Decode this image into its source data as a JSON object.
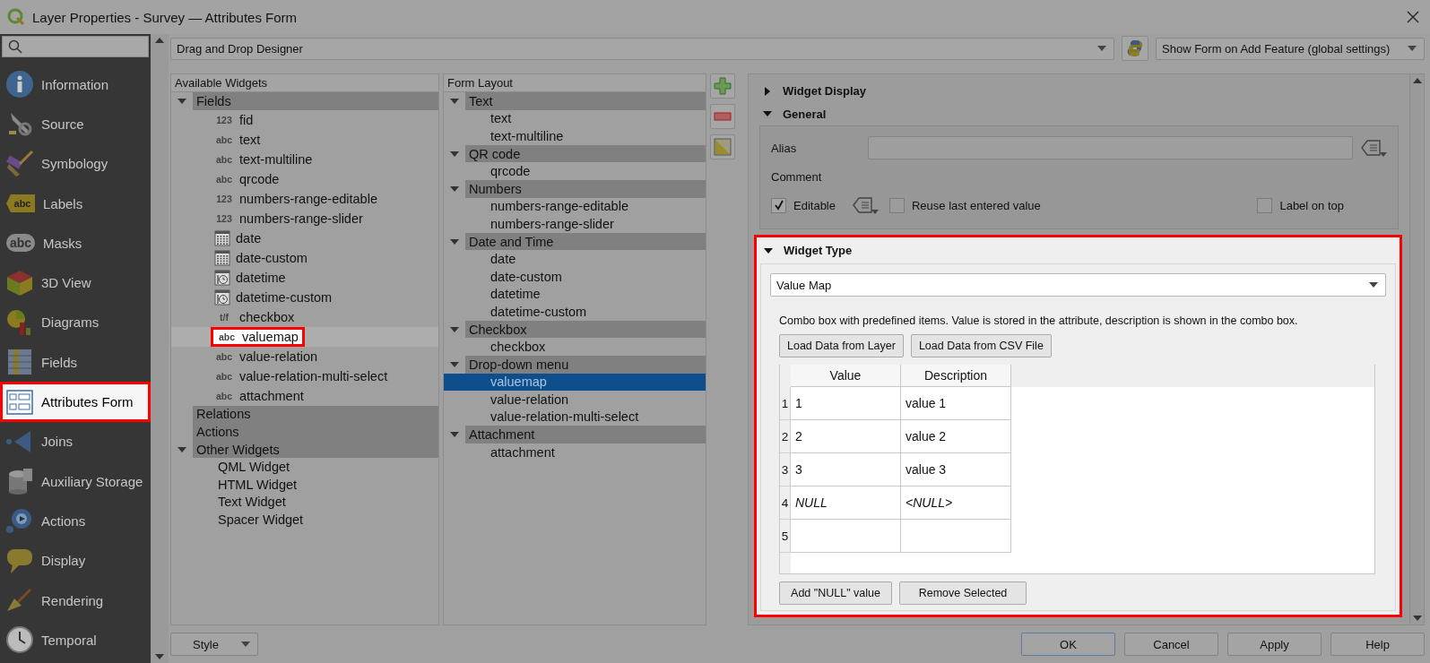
{
  "window": {
    "title": "Layer Properties - Survey — Attributes Form"
  },
  "sidebar": {
    "items": [
      {
        "label": "Information",
        "selected": false,
        "highlighted": false
      },
      {
        "label": "Source",
        "selected": false,
        "highlighted": false
      },
      {
        "label": "Symbology",
        "selected": false,
        "highlighted": false
      },
      {
        "label": "Labels",
        "badge": "abc",
        "selected": false,
        "highlighted": false
      },
      {
        "label": "Masks",
        "badge": "abc",
        "selected": false,
        "highlighted": false
      },
      {
        "label": "3D View",
        "selected": false,
        "highlighted": false
      },
      {
        "label": "Diagrams",
        "selected": false,
        "highlighted": false
      },
      {
        "label": "Fields",
        "selected": false,
        "highlighted": false
      },
      {
        "label": "Attributes Form",
        "selected": true,
        "highlighted": true
      },
      {
        "label": "Joins",
        "selected": false,
        "highlighted": false
      },
      {
        "label": "Auxiliary Storage",
        "selected": false,
        "highlighted": false
      },
      {
        "label": "Actions",
        "selected": false,
        "highlighted": false
      },
      {
        "label": "Display",
        "selected": false,
        "highlighted": false
      },
      {
        "label": "Rendering",
        "selected": false,
        "highlighted": false
      },
      {
        "label": "Temporal",
        "selected": false,
        "highlighted": false
      }
    ]
  },
  "designer_mode": {
    "value": "Drag and Drop Designer"
  },
  "show_form_mode": {
    "value": "Show Form on Add Feature (global settings)"
  },
  "available_widgets": {
    "header": "Available Widgets",
    "tree": [
      {
        "label": "Fields",
        "expanded": true,
        "children": [
          {
            "label": "fid",
            "kind": "number",
            "badge": "123",
            "highlighted": false
          },
          {
            "label": "text",
            "kind": "text",
            "badge": "abc",
            "highlighted": false
          },
          {
            "label": "text-multiline",
            "kind": "text",
            "badge": "abc",
            "highlighted": false
          },
          {
            "label": "qrcode",
            "kind": "text",
            "badge": "abc",
            "highlighted": false
          },
          {
            "label": "numbers-range-editable",
            "kind": "number",
            "badge": "123",
            "highlighted": false
          },
          {
            "label": "numbers-range-slider",
            "kind": "number",
            "badge": "123",
            "highlighted": false
          },
          {
            "label": "date",
            "kind": "date",
            "highlighted": false
          },
          {
            "label": "date-custom",
            "kind": "date",
            "highlighted": false
          },
          {
            "label": "datetime",
            "kind": "datetime",
            "highlighted": false
          },
          {
            "label": "datetime-custom",
            "kind": "datetime",
            "highlighted": false
          },
          {
            "label": "checkbox",
            "kind": "bool",
            "badge": "t/f",
            "highlighted": false
          },
          {
            "label": "valuemap",
            "kind": "text",
            "badge": "abc",
            "highlighted": true
          },
          {
            "label": "value-relation",
            "kind": "text",
            "badge": "abc",
            "highlighted": false
          },
          {
            "label": "value-relation-multi-select",
            "kind": "text",
            "badge": "abc",
            "highlighted": false
          },
          {
            "label": "attachment",
            "kind": "text",
            "badge": "abc",
            "highlighted": false
          }
        ]
      },
      {
        "label": "Relations"
      },
      {
        "label": "Actions"
      },
      {
        "label": "Other Widgets",
        "expanded": true,
        "children": [
          {
            "label": "QML Widget",
            "kind": "plain",
            "highlighted": false
          },
          {
            "label": "HTML Widget",
            "kind": "plain",
            "highlighted": false
          },
          {
            "label": "Text Widget",
            "kind": "plain",
            "highlighted": false
          },
          {
            "label": "Spacer Widget",
            "kind": "plain",
            "highlighted": false
          }
        ]
      }
    ]
  },
  "form_layout": {
    "header": "Form Layout",
    "groups": [
      {
        "label": "Text",
        "expanded": true,
        "children": [
          {
            "label": "text",
            "selected": false
          },
          {
            "label": "text-multiline",
            "selected": false
          }
        ]
      },
      {
        "label": "QR code",
        "expanded": true,
        "children": [
          {
            "label": "qrcode",
            "selected": false
          }
        ]
      },
      {
        "label": "Numbers",
        "expanded": true,
        "children": [
          {
            "label": "numbers-range-editable",
            "selected": false
          },
          {
            "label": "numbers-range-slider",
            "selected": false
          }
        ]
      },
      {
        "label": "Date and Time",
        "expanded": true,
        "children": [
          {
            "label": "date",
            "selected": false
          },
          {
            "label": "date-custom",
            "selected": false
          },
          {
            "label": "datetime",
            "selected": false
          },
          {
            "label": "datetime-custom",
            "selected": false
          }
        ]
      },
      {
        "label": "Checkbox",
        "expanded": true,
        "children": [
          {
            "label": "checkbox",
            "selected": false
          }
        ]
      },
      {
        "label": "Drop-down menu",
        "expanded": true,
        "children": [
          {
            "label": "valuemap",
            "selected": true
          },
          {
            "label": "value-relation",
            "selected": false
          },
          {
            "label": "value-relation-multi-select",
            "selected": false
          }
        ]
      },
      {
        "label": "Attachment",
        "expanded": true,
        "children": [
          {
            "label": "attachment",
            "selected": false
          }
        ]
      }
    ]
  },
  "widget_display": {
    "title": "Widget Display",
    "expanded": false
  },
  "general": {
    "title": "General",
    "expanded": true,
    "alias_label": "Alias",
    "comment_label": "Comment",
    "editable": {
      "label": "Editable",
      "checked": true
    },
    "reuse_last": {
      "label": "Reuse last entered value",
      "checked": false
    },
    "label_on_top": {
      "label": "Label on top",
      "checked": false
    }
  },
  "widget_type": {
    "title": "Widget Type",
    "expanded": true,
    "highlighted": true,
    "value": "Value Map",
    "description": "Combo box with predefined items. Value is stored in the attribute, description is shown in the combo box.",
    "load_buttons": [
      "Load Data from Layer",
      "Load Data from CSV File"
    ],
    "table": {
      "columns": [
        "Value",
        "Description"
      ],
      "rows": [
        {
          "number": "1",
          "value": "1",
          "description": "value 1",
          "kind": "plain"
        },
        {
          "number": "2",
          "value": "2",
          "description": "value 2",
          "kind": "plain"
        },
        {
          "number": "3",
          "value": "3",
          "description": "value 3",
          "kind": "plain"
        },
        {
          "number": "4",
          "value": "NULL",
          "description": "<NULL>",
          "kind": "null"
        },
        {
          "number": "5",
          "kind": "plain"
        }
      ]
    },
    "action_buttons": [
      "Add \"NULL\" value",
      "Remove Selected"
    ]
  },
  "footer": {
    "style_button": "Style",
    "buttons": [
      {
        "label": "OK",
        "default": true
      },
      {
        "label": "Cancel",
        "default": false
      },
      {
        "label": "Apply",
        "default": false
      },
      {
        "label": "Help",
        "default": false
      }
    ]
  }
}
